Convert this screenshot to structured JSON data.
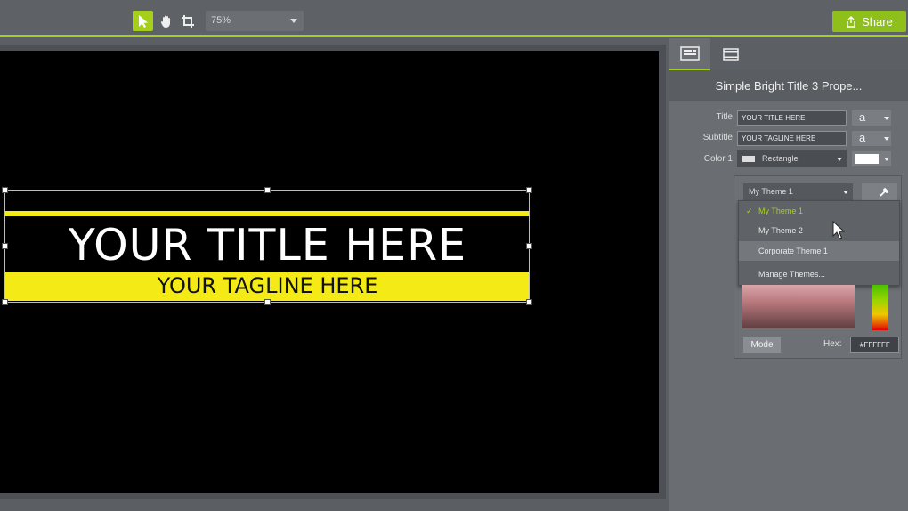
{
  "toolbar": {
    "tools": [
      {
        "name": "select",
        "active": true
      },
      {
        "name": "pan",
        "active": false
      },
      {
        "name": "crop",
        "active": false
      }
    ],
    "zoom": "75%",
    "share_label": "Share"
  },
  "canvas": {
    "title_text": "YOUR TITLE HERE",
    "tagline_text": "YOUR TAGLINE HERE",
    "accent_color": "#f4ea16"
  },
  "panel": {
    "header": "Simple Bright Title 3 Prope...",
    "title_label": "Title",
    "title_value": "YOUR TITLE HERE",
    "subtitle_label": "Subtitle",
    "subtitle_value": "YOUR TAGLINE HERE",
    "color_label": "Color 1",
    "color_value": "Rectangle",
    "font_glyph": "a",
    "theme_select": "My Theme 1",
    "menu": [
      {
        "label": "My Theme 1",
        "checked": true
      },
      {
        "label": "My Theme 2",
        "checked": false
      },
      {
        "label": "Corporate Theme 1",
        "checked": false
      },
      {
        "label": "Manage Themes...",
        "checked": false
      }
    ],
    "mode_label": "Mode",
    "hex_label": "Hex:",
    "hex_value": "#FFFFFF"
  },
  "colors": {
    "accent": "#a6cf1c"
  }
}
